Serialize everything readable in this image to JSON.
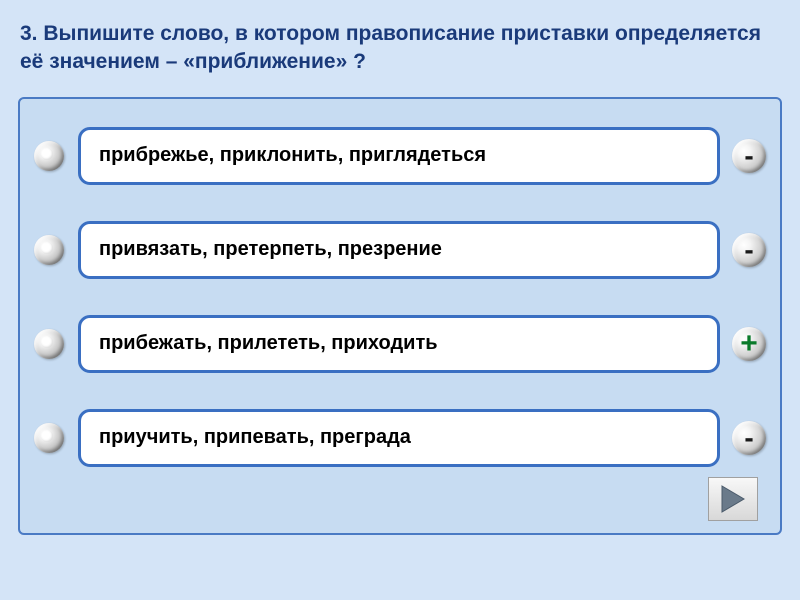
{
  "question": "3. Выпишите слово, в котором правописание приставки определяется её значением – «приближение» ?",
  "options": [
    {
      "text": "прибрежье, приклонить, приглядеться",
      "mark": "-",
      "correct": false
    },
    {
      "text": "привязать, претерпеть, презрение",
      "mark": "-",
      "correct": false
    },
    {
      "text": "прибежать, прилететь, приходить",
      "mark": "+",
      "correct": true
    },
    {
      "text": "приучить, припевать, преграда",
      "mark": "-",
      "correct": false
    }
  ]
}
